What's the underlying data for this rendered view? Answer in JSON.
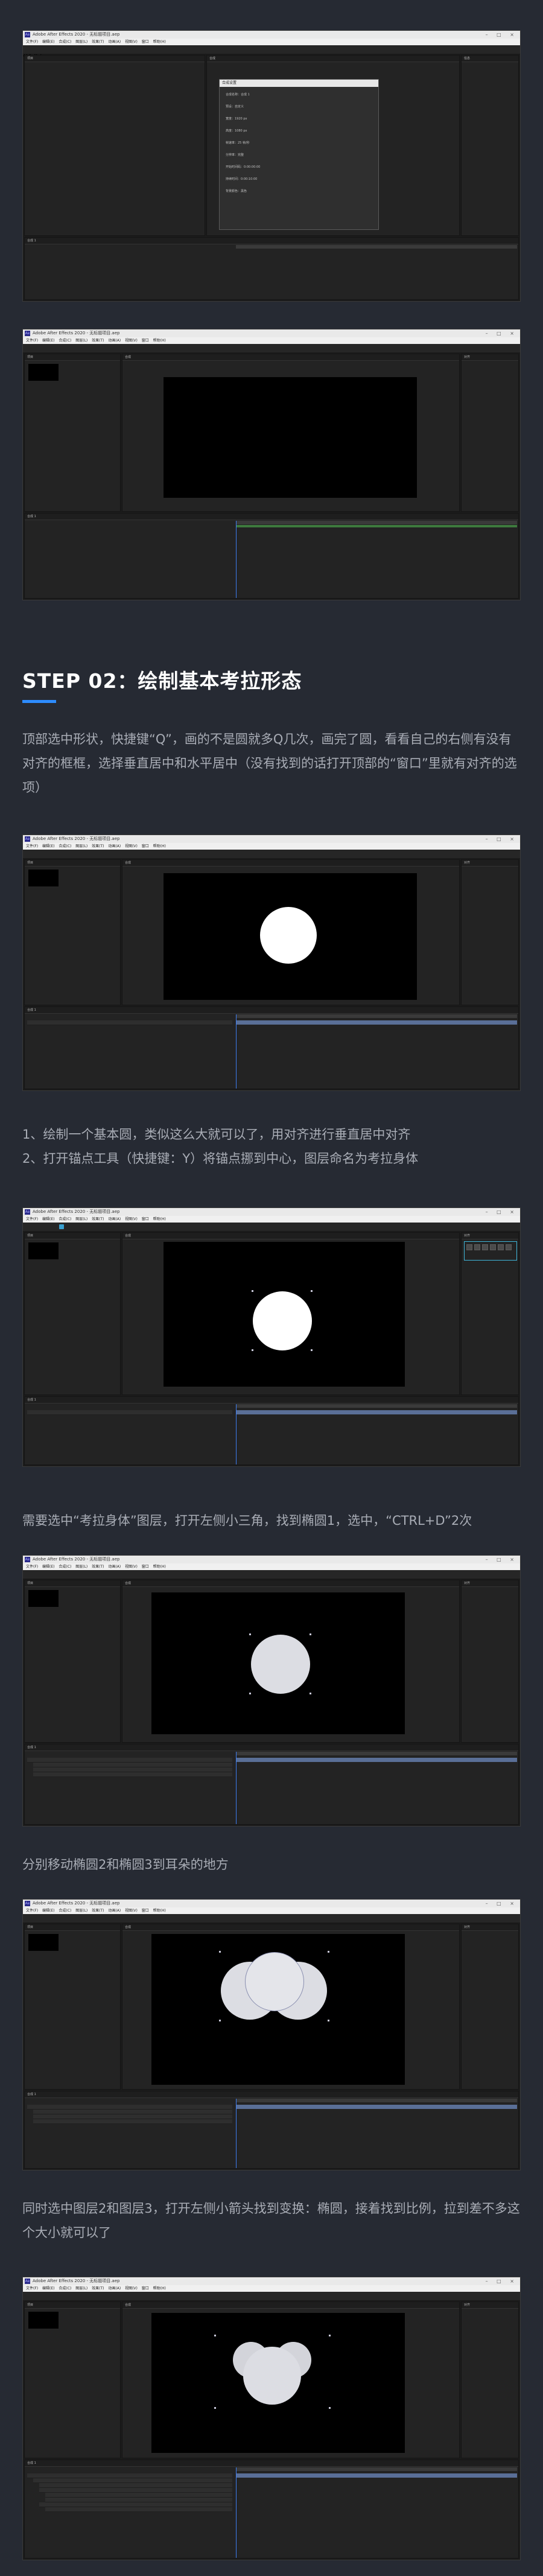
{
  "step": {
    "heading": "STEP 02：绘制基本考拉形态"
  },
  "paragraphs": {
    "p1": "顶部选中形状，快捷键“Q”，画的不是圆就多Q几次，画完了圆，看看自己的右侧有没有对齐的框框，选择垂直居中和水平居中（没有找到的话打开顶部的“窗口”里就有对齐的选项）",
    "p2_line1": "1、绘制一个基本圆，类似这么大就可以了，用对齐进行垂直居中对齐",
    "p2_line2": "2、打开锚点工具（快捷键：Y）将锚点挪到中心，图层命名为考拉身体",
    "p3": "需要选中“考拉身体”图层，打开左侧小三角，找到椭圆1，选中，“CTRL+D”2次",
    "p4": "分别移动椭圆2和椭圆3到耳朵的地方",
    "p5": "同时选中图层2和图层3，打开左侧小箭头找到变换：椭圆，接着找到比例，拉到差不多这个大小就可以了"
  },
  "app_window": {
    "title": "Adobe After Effects 2020 - 无标题项目.aep",
    "menu": "文件(F) 编辑(E) 合成(C) 图层(L) 效果(T) 动画(A) 视图(V) 窗口 帮助(H)"
  },
  "panels": {
    "project": "项目",
    "composition": "合成",
    "timeline": "合成 1",
    "effects": "效果和预设",
    "align": "对齐",
    "info": "信息"
  },
  "dialog": {
    "title": "合成设置",
    "ok": "确定",
    "cancel": "取消",
    "rows": [
      "合成名称：合成 1",
      "预设：自定义",
      "宽度：1920 px",
      "高度：1080 px",
      "帧速率：25 帧/秒",
      "分辨率：完整",
      "开始时间码：0:00:00:00",
      "持续时间：0:00:10:00",
      "背景颜色：黑色"
    ]
  },
  "colors": {
    "page_bg": "#262a33",
    "heading": "#ffffff",
    "body_text": "#a9adb6",
    "accent": "#2d8cff"
  }
}
